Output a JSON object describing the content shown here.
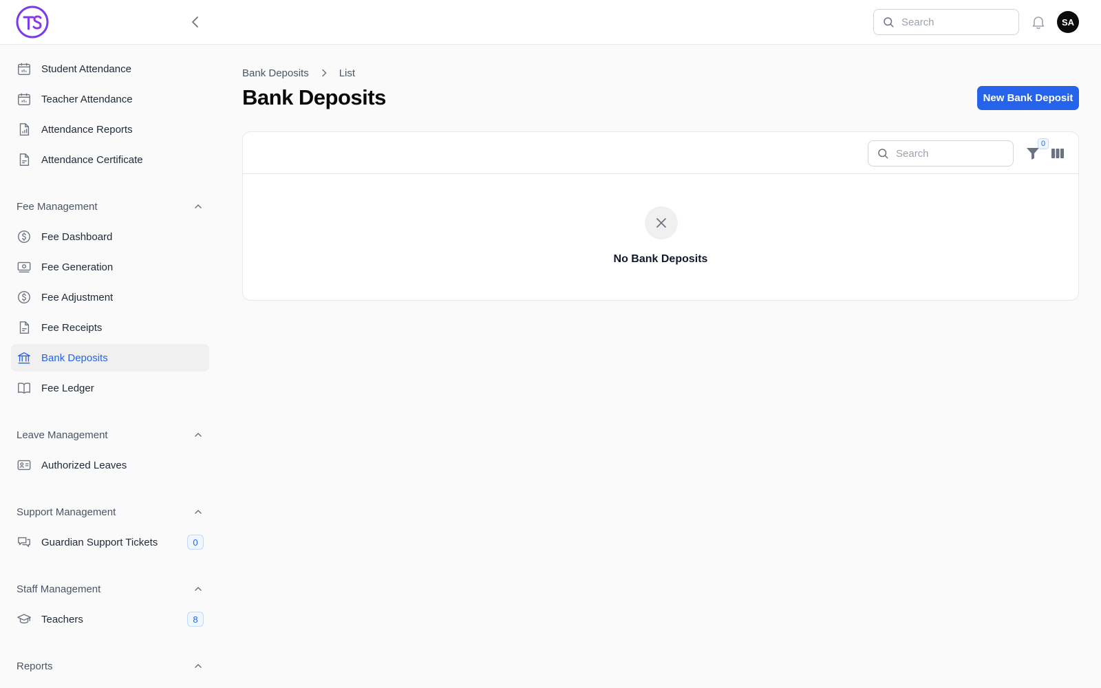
{
  "header": {
    "logo_text": "TS",
    "search_placeholder": "Search",
    "avatar_initials": "SA"
  },
  "sidebar": {
    "attendance_items": [
      {
        "label": "Student Attendance",
        "icon": "calendar-icon"
      },
      {
        "label": "Teacher Attendance",
        "icon": "calendar-icon"
      },
      {
        "label": "Attendance Reports",
        "icon": "chart-document-icon"
      },
      {
        "label": "Attendance Certificate",
        "icon": "document-icon"
      }
    ],
    "groups": [
      {
        "label": "Fee Management",
        "expanded": true
      },
      {
        "label": "Leave Management",
        "expanded": true
      },
      {
        "label": "Support Management",
        "expanded": true
      },
      {
        "label": "Staff Management",
        "expanded": true
      },
      {
        "label": "Reports",
        "expanded": true
      }
    ],
    "fee_items": [
      {
        "label": "Fee Dashboard",
        "icon": "dollar-circle-icon"
      },
      {
        "label": "Fee Generation",
        "icon": "banknote-icon"
      },
      {
        "label": "Fee Adjustment",
        "icon": "dollar-circle-icon"
      },
      {
        "label": "Fee Receipts",
        "icon": "document-icon"
      },
      {
        "label": "Bank Deposits",
        "icon": "bank-icon",
        "active": true
      },
      {
        "label": "Fee Ledger",
        "icon": "book-icon"
      }
    ],
    "leave_items": [
      {
        "label": "Authorized Leaves",
        "icon": "id-card-icon"
      }
    ],
    "support_items": [
      {
        "label": "Guardian Support Tickets",
        "icon": "chat-bubbles-icon",
        "badge": "0"
      }
    ],
    "staff_items": [
      {
        "label": "Teachers",
        "icon": "graduation-cap-icon",
        "badge": "8"
      }
    ]
  },
  "main": {
    "breadcrumb": [
      "Bank Deposits",
      "List"
    ],
    "title": "Bank Deposits",
    "new_button_label": "New Bank Deposit",
    "table": {
      "search_placeholder": "Search",
      "filter_count": "0",
      "empty_message": "No Bank Deposits"
    }
  },
  "colors": {
    "accent": "#2563eb",
    "logo": "#7c3aed"
  }
}
